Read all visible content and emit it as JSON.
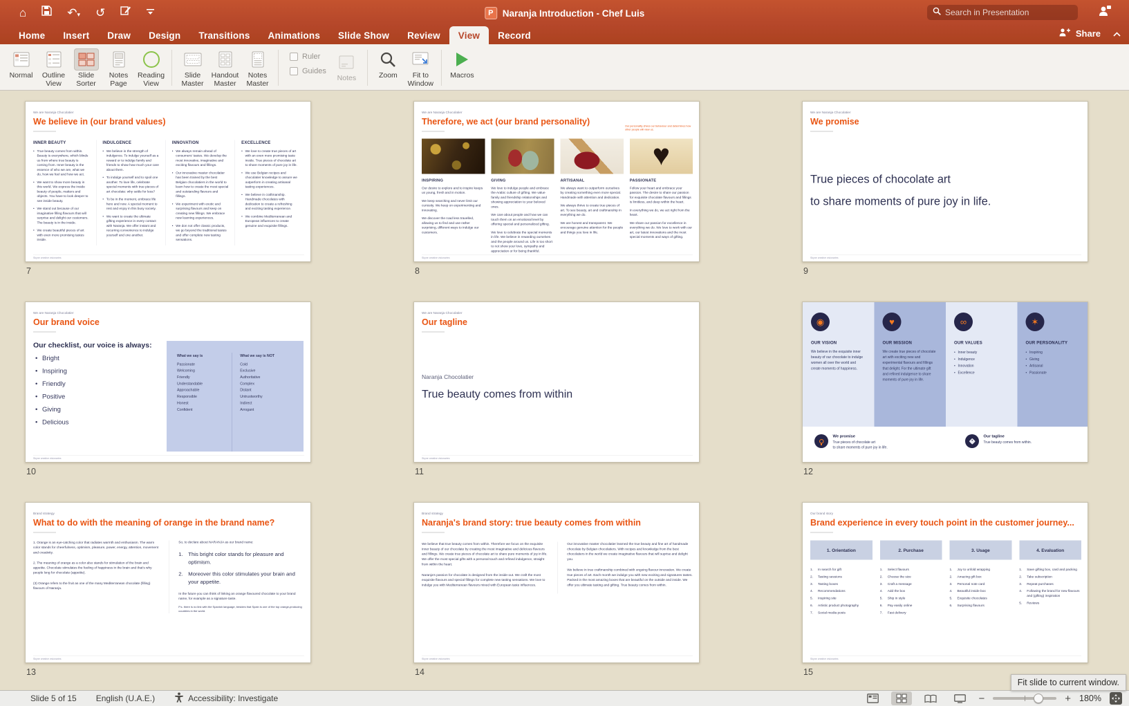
{
  "titlebar": {
    "title": "Naranja Introduction - Chef Luis",
    "search_placeholder": "Search in Presentation",
    "app_glyph": "P"
  },
  "tabs": [
    "Home",
    "Insert",
    "Draw",
    "Design",
    "Transitions",
    "Animations",
    "Slide Show",
    "Review",
    "View",
    "Record"
  ],
  "active_tab": "View",
  "share_label": "Share",
  "ribbon": {
    "normal": "Normal",
    "outline_view": "Outline View",
    "slide_sorter": "Slide Sorter",
    "notes_page": "Notes Page",
    "reading_view": "Reading View",
    "slide_master": "Slide Master",
    "handout_master": "Handout Master",
    "notes_master": "Notes Master",
    "ruler": "Ruler",
    "guides": "Guides",
    "notes": "Notes",
    "zoom": "Zoom",
    "fit_to_window": "Fit to Window",
    "macros": "Macros"
  },
  "slides": [
    {
      "number": "7",
      "kicker": "We are Naranja Chocolatier",
      "title": "We believe in (our brand values)",
      "footer": "Skyne creative visionaries",
      "columns": [
        {
          "header": "INNER BEAUTY",
          "bullets": [
            "True beauty comes from within. Beauty is everywhere, which blinds us from where true beauty is coming from. Inner beauty is the essence of who we are, what we do, how we feel and how we act.",
            "We want to show more beauty in this world. We express the inside beauty of people, matters and objects. You have to look deeper to see inside beauty.",
            "We stand out because of our imaginative filling flavours that will surprise and delight our customers. The beauty is in the inside.",
            "We create beautiful pieces of art with even more promising tastes inside."
          ]
        },
        {
          "header": "INDULGENCE",
          "bullets": [
            "We believe in the strength of indulgence. To indulge yourself as a reward or to indulge family and friends to show how much your care about them.",
            "To indulge yourself and to spoil one another. To love life, celebrate special moments with true pieces of art chocolate: why settle for less?",
            "To be in the moment, embrace life here and now. A special moment to rest and enjoy in this busy society.",
            "We want to create the ultimate gifting experience in every contact with Naranja. We offer instant and recurring convenience to indulge yourself and one another."
          ]
        },
        {
          "header": "INNOVATION",
          "bullets": [
            "We always remain ahead of consumers' tastes. We develop the most innovative, imaginative and exciting flavours and fillings.",
            "Our innovative master chocolatier has been trained by the best Belgian chocolatiers in the world to learn how to create the most special and outstanding flavours and fillings.",
            "We experiment with exotic and surprising flavours and keep on creating new fillings. We embrace new learning experiences.",
            "We don not offer classic products, we go beyond the traditional tastes and offer complete new tasting sensations."
          ]
        },
        {
          "header": "EXCELLENCE",
          "bullets": [
            "We love to create true pieces of art with an even more promising taste inside. True pieces of chocolate art to share moments of pure joy in life.",
            "We use Belgian recipes and chocolatier knowledge to assure we outperform in creating artisanal tasting experiences.",
            "We believe in craftmanship. Handmade chocolates with dedication to create a refreshing and exciting tasting experience.",
            "We combine Mediterranean and European influences to create genuine and exquisite fillings."
          ]
        }
      ]
    },
    {
      "number": "8",
      "kicker": "We are Naranja Chocolatier",
      "title": "Therefore, we act (our brand personality)",
      "note": "Our personality drives our behaviour and determines how other people will view us.",
      "footer": "Skyne creative visionaries",
      "columns": [
        {
          "header": "INSPIRING",
          "photo": "chocolate-photo",
          "paras": [
            "Our desire to explore and to inspire keeps us young, fresh and in motion.",
            "We keep searching and never limit our curiosity. We keep on experimenting and innovating.",
            "We discover the road less travelled, allowing us to find and use rather surprising, different ways to indulge our customers."
          ]
        },
        {
          "header": "GIVING",
          "photo": "gift-photo",
          "paras": [
            "We love to indulge people and embrace the Arabic culture of gifting. We value family and friendship relationships and showing appreciation to your beloved ones.",
            "We care about people and how we can touch them on an emotional level by offering special and personalized gifting.",
            "We love to celebrate the special moments in life. We believe in rewarding ourselves and the people around us. Life is too short to not show your love, sympathy and appreciation or for being thankful."
          ]
        },
        {
          "header": "ARTISANAL",
          "photo": "paintbrush-photo",
          "paras": [
            "We always want to outperform ourselves by creating something even more special. Handmade with attention and dedication.",
            "We always thrive to create true pieces of art. To see beauty, art and craftmanship in everything we do.",
            "We are honest and transparent. We encourage genuine attention for the people and things you love in life."
          ]
        },
        {
          "header": "PASSIONATE",
          "photo": "heart-hands-photo",
          "paras": [
            "Follow your heart and embrace your passion. The desire to share our passion for exquisite chocolate flavours and fillings is limitless, and deep within the heart.",
            "In everything we do, we act right from the heart.",
            "We share our passion for excellence in everything we do. We love to work with our art, our latest innovations and the most special moments and ways of gifting."
          ]
        }
      ]
    },
    {
      "number": "9",
      "kicker": "We are Naranja Chocolatier",
      "title": "We promise",
      "lines": [
        "True pieces of chocolate art",
        "to share moments of pure joy in life."
      ],
      "footer": "Skyne creative visionaries"
    },
    {
      "number": "10",
      "kicker": "We are Naranja Chocolatier",
      "title": "Our brand voice",
      "checklist_heading": "Our checklist, our voice is always:",
      "checklist": [
        "Bright",
        "Inspiring",
        "Friendly",
        "Positive",
        "Giving",
        "Delicious"
      ],
      "say_header": "What we say is",
      "say_items": [
        "Passionate",
        "Welcoming",
        "Friendly",
        "Understandable",
        "Approachable",
        "Responsible",
        "Honest",
        "Confident"
      ],
      "not_header": "What we say is NOT",
      "not_items": [
        "Cold",
        "Exclusive",
        "Authoritative",
        "Complex",
        "Distant",
        "Untrustworthy",
        "Indirect",
        "Arrogant"
      ],
      "footer": "Skyne creative visionaries"
    },
    {
      "number": "11",
      "kicker": "We are Naranja Chocolatier",
      "title": "Our tagline",
      "brand": "Naranja Chocolatier",
      "tagline": "True beauty comes from within",
      "footer": "Skyne creative visionaries"
    },
    {
      "number": "12",
      "cards": [
        {
          "header": "OUR VISION",
          "icon": "eye-icon",
          "glyph": "◉",
          "text": "We believe in the exquisite inner beauty of our chocolate to indulge women all over the world and create moments of happiness."
        },
        {
          "header": "OUR MISSION",
          "icon": "heart-icon",
          "glyph": "♥",
          "text": "We create true pieces of chocolate art with exciting new and experimental flavours and fillings that delight. For the ultimate gift and refined indulgence to share moments of pure joy in life."
        },
        {
          "header": "OUR VALUES",
          "icon": "chain-link-icon",
          "glyph": "∞",
          "bullets": [
            "Inner beauty",
            "Indulgence",
            "Innovation",
            "Excellence"
          ]
        },
        {
          "header": "OUR PERSONALITY",
          "icon": "sparkle-icon",
          "glyph": "✶",
          "bullets": [
            "Inspiring",
            "Giving",
            "Artisanal",
            "Passionate"
          ]
        }
      ],
      "bottom": [
        {
          "icon": "lightbulb-icon",
          "label": "We promise",
          "text": "True pieces of chocolate art\nto share moments of pure joy in life."
        },
        {
          "icon": "tag-icon",
          "label": "Our tagline",
          "text": "True beauty comes from within."
        }
      ]
    },
    {
      "number": "13",
      "kicker": "Brand strategy",
      "title": "What to do with the meaning of orange in the brand name?",
      "left_items": [
        "1.  Orange is an eye-catching color that radiates warmth and enthusiasm. The warm color stands for cheerfulness, optimism, pleasure, power, energy, attention, movement and creativity.",
        "2.  The meaning of orange as a color also stands for stimulation of the brain and appetite. Chocolate stimulates the feeling of happiness in the brain and that's why people long for chocolate (appetite).",
        "(3) Orange refers to the fruit as one of the many Mediterranean chocolate (filling) flavours of Naranja."
      ],
      "right_intro": "So, to declare about NARANJA as our brand name:",
      "right_points": [
        "This bright color stands for pleasure and optimism.",
        "Moreover this color stimulates your brain and your appetite."
      ],
      "right_outro": "In the future you can think of linking an orange flavoured chocolate to your brand name, for example as a signature taste.",
      "right_ps": "P.s. there is no link with the Spanish language, besides that Spain is one of the top orange-producing countries in the world.",
      "footer": "Skyne creative visionaries"
    },
    {
      "number": "14",
      "kicker": "Brand strategy",
      "title": "Naranja's brand story: true beauty comes from within",
      "left_paras": [
        "We believe that true beauty comes from within. Therefore we focus on the exquisite inner beauty of our chocolate by creating the most imaginative and delicious flavours and fillings. We create true pieces of chocolate art to share pure moments of joy in life. We offer the most special gifts with a personal touch and refined indulgence, straight from within the heart.",
        "Naranja's passion for chocolate is designed from the inside-out. We craft the most exquisite flavours and special fillings for complete new tasting sensations. We love to indulge you with Mediterranean flavours mixed with European taste influences."
      ],
      "right_paras": [
        "Our innovative master chocolatier learned the true beauty and fine art of handmade chocolate by Belgian chocolatiers. With recipes and knowledge from the best chocolatiers in the world we create imaginative flavours that will suprise and delight you.",
        "We believe in true craftmanship combined with ongoing flavour innovation. We create true pieces of art. Each month we indulge you with new exciting and signatures tastes. Packed in the most amazing boxes that are beautiful on the outside and inside. We offer you ultimate tasting and gifting. True beauty comes from within."
      ],
      "footer": "Skyne creative visionaries"
    },
    {
      "number": "15",
      "kicker": "Our brand story",
      "title": "Brand experience in every touch point in the customer journey...",
      "columns": [
        {
          "header": "1. Orientation",
          "items": [
            "In search for gift",
            "Tasting sessions",
            "Tasting boxes",
            "Recommendations",
            "Inspiring site",
            "Artistic product photography",
            "Social media posts"
          ]
        },
        {
          "header": "2. Purchase",
          "items": [
            "Select flavours",
            "Choose the size",
            "Craft a message",
            "Add the box",
            "Ship in style",
            "Pay easily online",
            "Fast delivery"
          ]
        },
        {
          "header": "3. Usage",
          "items": [
            "Joy to unfold wrapping",
            "Amazing gift box",
            "Personal note card",
            "Beautiful inside box",
            "Exquisite chocolates",
            "Surprising flavours"
          ]
        },
        {
          "header": "4. Evaluation",
          "items": [
            "Save gifting box, card and packing",
            "Take subscription",
            "Repeat purchases",
            "Following the brand for new flavours and (gifting) inspiration",
            "Reviews"
          ]
        }
      ],
      "footer": "Skyne creative visionaries"
    }
  ],
  "statusbar": {
    "slide_label": "Slide 5 of 15",
    "language": "English (U.A.E.)",
    "accessibility": "Accessibility: Investigate",
    "zoom_level": "180%",
    "tooltip": "Fit slide to current window."
  },
  "colors": {
    "accent_orange": "#E95513",
    "header_red": "#B7472A",
    "navy": "#2E3152",
    "panel_blue": "#C3CDE9",
    "card_light": "#E4E9F5",
    "card_medium": "#A9B7DB",
    "canvas_beige": "#E5DECA"
  }
}
